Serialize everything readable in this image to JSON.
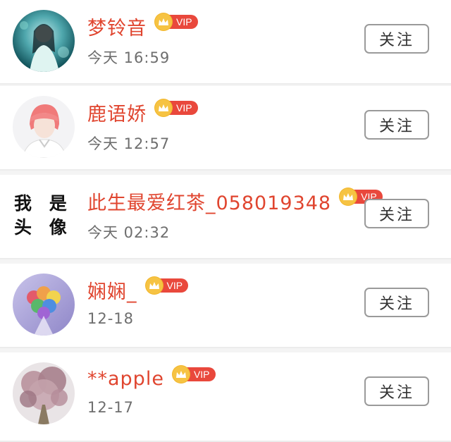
{
  "follow_list": {
    "items": [
      {
        "name": "梦铃音",
        "vip_label": "VIP",
        "time": "今天 16:59",
        "follow_label": "关注",
        "avatar": "photo"
      },
      {
        "name": "鹿语娇",
        "vip_label": "VIP",
        "time": "今天 12:57",
        "follow_label": "关注",
        "avatar": "photo"
      },
      {
        "name": "此生最爱红茶_058019348",
        "vip_label": "VIP",
        "time": "今天 02:32",
        "follow_label": "关注",
        "avatar": "text",
        "avatar_text": [
          "我 是",
          "头 像"
        ]
      },
      {
        "name": "娴娴_",
        "vip_label": "VIP",
        "time": "12-18",
        "follow_label": "关注",
        "avatar": "photo"
      },
      {
        "name": "**apple",
        "vip_label": "VIP",
        "time": "12-17",
        "follow_label": "关注",
        "avatar": "photo"
      }
    ]
  },
  "colors": {
    "name": "#e0452f",
    "vip_badge": "#e9483c",
    "crown": "#f6c343",
    "time": "#6e6e6e",
    "button_border": "#9a9a9a"
  },
  "icons": {
    "vip": "crown-icon"
  }
}
